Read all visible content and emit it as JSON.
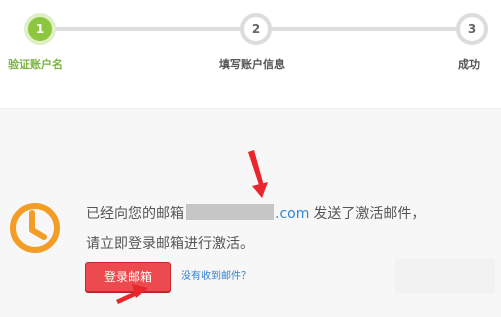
{
  "steps": [
    {
      "number": "1",
      "label": "验证账户名",
      "state": "active"
    },
    {
      "number": "2",
      "label": "填写账户信息",
      "state": "pending"
    },
    {
      "number": "3",
      "label": "成功",
      "state": "pending"
    }
  ],
  "message": {
    "line1_prefix": "已经向您的邮箱",
    "email_domain": ".com",
    "line1_suffix": "发送了激活邮件，",
    "line2": "请立即登录邮箱进行激活。"
  },
  "actions": {
    "login_button": "登录邮箱",
    "not_received_link": "没有收到邮件？"
  },
  "colors": {
    "active_step": "#8dc63f",
    "login_button": "#ec4a4e",
    "link": "#2f8ad8",
    "clock_icon": "#f39c26",
    "annotation_arrow": "#e8262c"
  },
  "icons": {
    "status_icon": "clock-icon",
    "annotations": "red-arrow-icon"
  }
}
